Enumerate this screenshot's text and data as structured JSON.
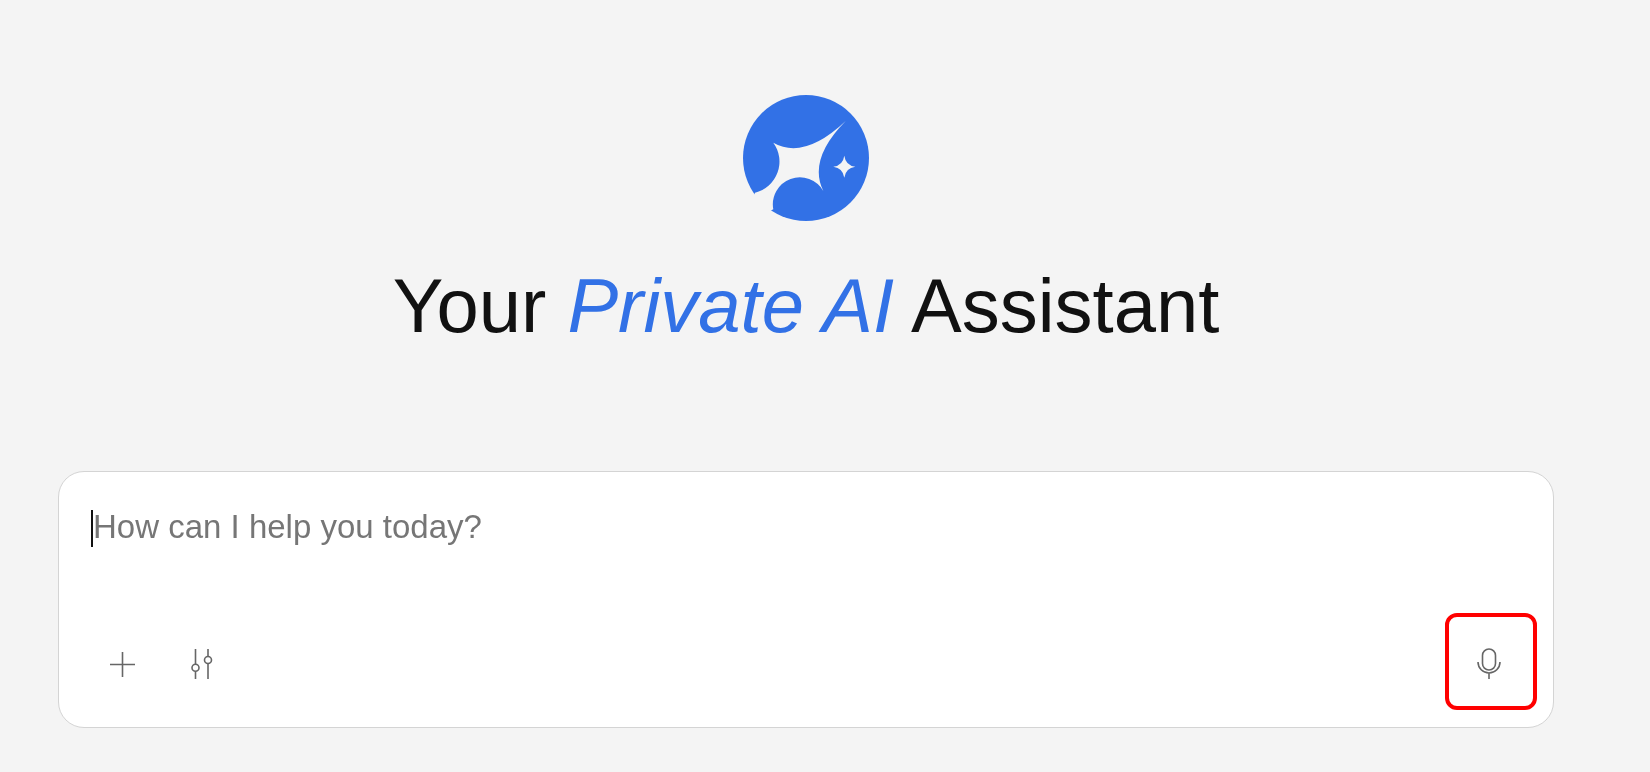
{
  "heading": "Your *Private AI* Assistant",
  "composer": {
    "placeholder": "How can I help you today?",
    "focused": true,
    "tools": [
      {
        "kind": "plus"
      },
      {
        "kind": "sliders"
      }
    ],
    "voice": {
      "kind": "mic",
      "highlighted": true
    }
  }
}
